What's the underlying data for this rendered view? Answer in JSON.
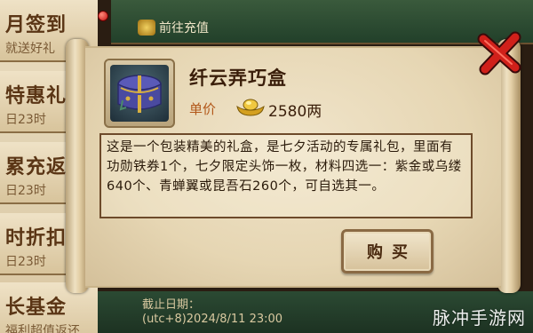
{
  "sidebar": {
    "items": [
      {
        "title": "月签到",
        "sub": "就送好礼"
      },
      {
        "title": "特惠礼",
        "sub": "日23时"
      },
      {
        "title": "累充返",
        "sub": "日23时"
      },
      {
        "title": "时折扣",
        "sub": "日23时"
      },
      {
        "title": "长基金",
        "sub": "福利超值返还"
      }
    ]
  },
  "topbar": {
    "recharge_label": "前往充值"
  },
  "bottombar": {
    "deadline_label": "截止日期：",
    "deadline_value": "(utc+8)2024/8/11 23:00"
  },
  "dialog": {
    "item_name": "纤云弄巧盒",
    "price_label": "单价",
    "price_value": "2580两",
    "description": "这是一个包装精美的礼盒，是七夕活动的专属礼包，里面有功勋铁券1个，七夕限定头饰一枚，材料四选一：紫金或乌缕640个、青蝉翼或昆吾石260个，可自选其一。",
    "buy_label": "购买"
  },
  "watermark": "脉冲手游网",
  "colors": {
    "close_red": "#d0201a",
    "price_label": "#b2581a",
    "ink": "#3a1e0a"
  }
}
